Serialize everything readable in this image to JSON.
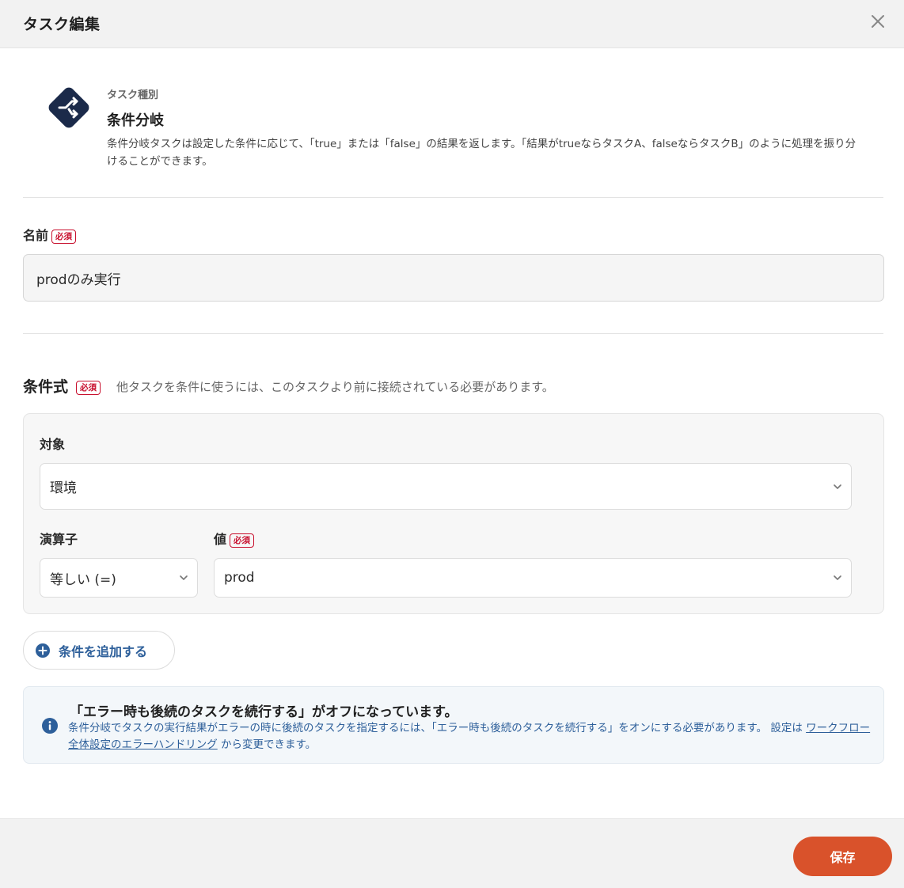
{
  "dialog": {
    "title": "タスク編集"
  },
  "task_type": {
    "label": "タスク種別",
    "name": "条件分岐",
    "description": "条件分岐タスクは設定した条件に応じて、「true」または「false」の結果を返します。「結果がtrueならタスクA、falseならタスクB」のように処理を振り分けることができます。"
  },
  "name_field": {
    "label": "名前",
    "required": "必須",
    "value": "prodのみ実行"
  },
  "condition": {
    "title": "条件式",
    "required": "必須",
    "note": "他タスクを条件に使うには、このタスクより前に接続されている必要があります。",
    "target_label": "対象",
    "target_value": "環境",
    "operator_label": "演算子",
    "operator_value": "等しい (=)",
    "value_label": "値",
    "value_required": "必須",
    "value_value": "prod",
    "add_button": "条件を追加する"
  },
  "info": {
    "title": "「エラー時も後続のタスクを続行する」がオフになっています。",
    "text_before": "条件分岐でタスクの実行結果がエラーの時に後続のタスクを指定するには、「エラー時も後続のタスクを続行する」をオンにする必要があります。 設定は ",
    "link": "ワークフロー全体設定のエラーハンドリング",
    "text_after": " から変更できます。"
  },
  "footer": {
    "save_label": "保存"
  },
  "colors": {
    "accent": "#d9522b",
    "link": "#2d5f9a",
    "required": "#c8102e",
    "icon_bg": "#1b2a4a"
  },
  "icons": {
    "close": "close-icon",
    "task_type": "branch-icon",
    "add": "plus-circle-icon",
    "info": "info-icon",
    "dropdown": "chevron-down-icon"
  }
}
